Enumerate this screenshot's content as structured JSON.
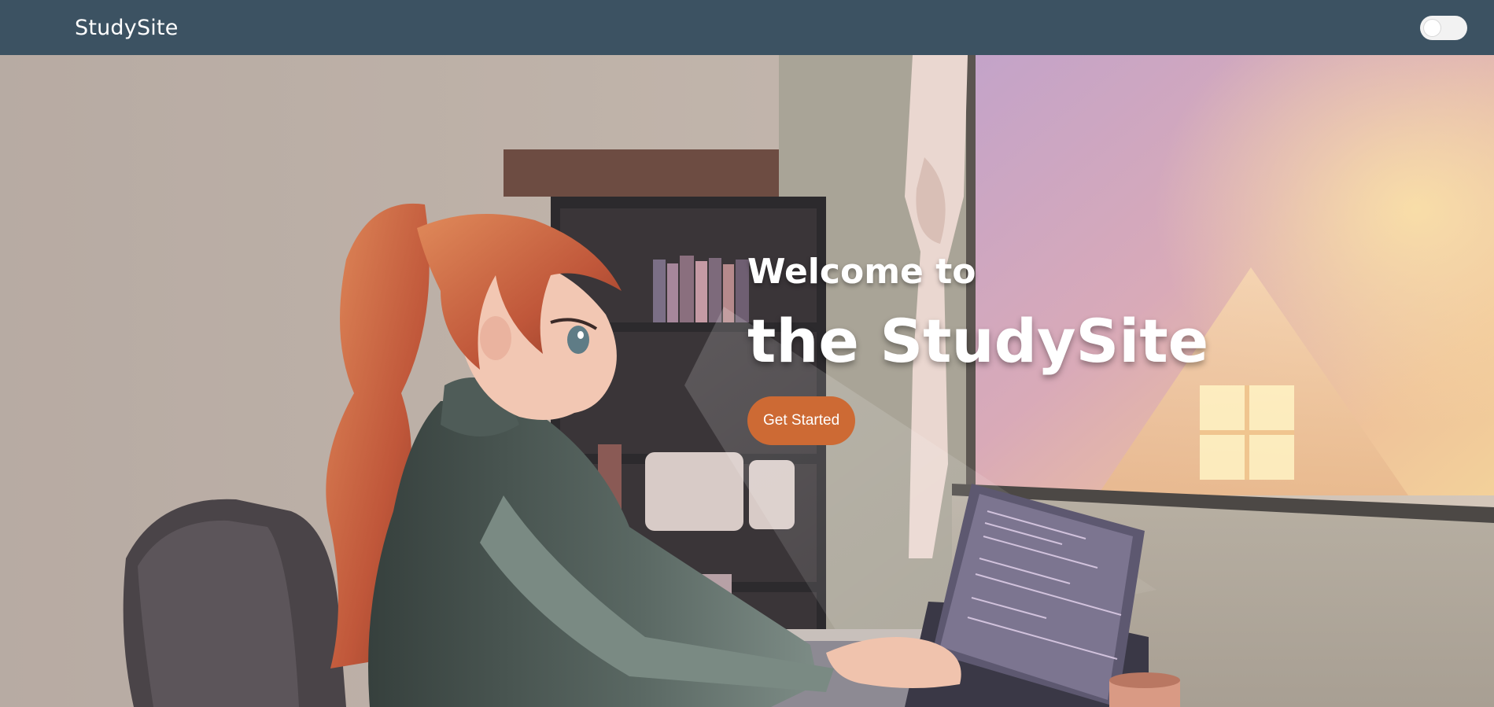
{
  "navbar": {
    "brand": "StudySite",
    "theme_toggle_state": "off"
  },
  "hero": {
    "welcome_line": "Welcome to",
    "site_line": "the StudySite",
    "cta_label": "Get Started",
    "accent_color": "#cd6a34",
    "navbar_color": "#3c5262",
    "background_image": "illustration of a girl studying at a laptop by a sunset window"
  }
}
